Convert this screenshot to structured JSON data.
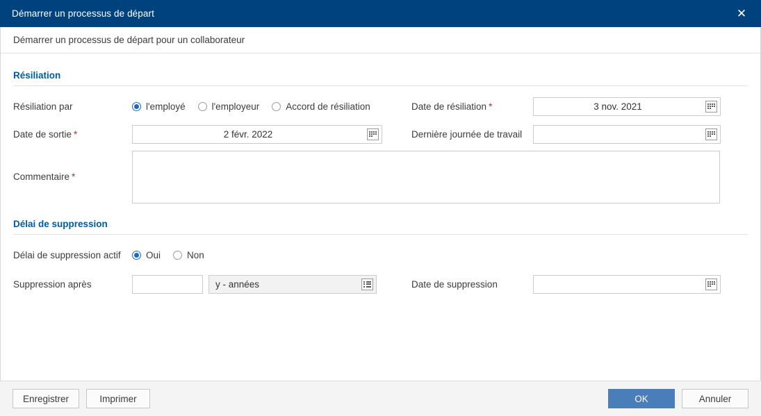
{
  "window": {
    "title": "Démarrer un processus de départ",
    "subtitle": "Démarrer un processus de départ pour un collaborateur",
    "close_icon": "close-icon",
    "close_glyph": "✕",
    "header_color": "#00427e",
    "accent_color": "#005b9e"
  },
  "sections": [
    {
      "id": "resiliation",
      "title": "Résiliation",
      "fields": {
        "resiliation_par": {
          "label": "Résiliation par",
          "options": [
            {
              "label": "l'employé",
              "selected": true
            },
            {
              "label": "l'employeur",
              "selected": false
            },
            {
              "label": "Accord de résiliation",
              "selected": false
            }
          ]
        },
        "date_resiliation": {
          "label": "Date de résiliation",
          "required": "*",
          "value": "3 nov. 2021",
          "icon": "calendar-icon"
        },
        "date_sortie": {
          "label": "Date de sortie",
          "required": "*",
          "value": "2 févr. 2022",
          "icon": "calendar-icon"
        },
        "derniere_journee": {
          "label": "Dernière journée de travail",
          "value": "",
          "icon": "calendar-icon"
        },
        "commentaire": {
          "label": "Commentaire",
          "required": "*",
          "value": ""
        }
      }
    },
    {
      "id": "delai-suppression",
      "title": "Délai de suppression",
      "fields": {
        "delai_actif": {
          "label": "Délai de suppression actif",
          "options": [
            {
              "label": "Oui",
              "selected": true
            },
            {
              "label": "Non",
              "selected": false
            }
          ]
        },
        "suppression_apres": {
          "label": "Suppression après",
          "value": "",
          "unit_value": "y - années",
          "unit_icon": "list-picker-icon"
        },
        "date_suppression": {
          "label": "Date de suppression",
          "value": "",
          "icon": "calendar-icon"
        }
      }
    }
  ],
  "footer": {
    "save_label": "Enregistrer",
    "print_label": "Imprimer",
    "ok_label": "OK",
    "cancel_label": "Annuler",
    "primary_color": "#4a7ebb"
  }
}
